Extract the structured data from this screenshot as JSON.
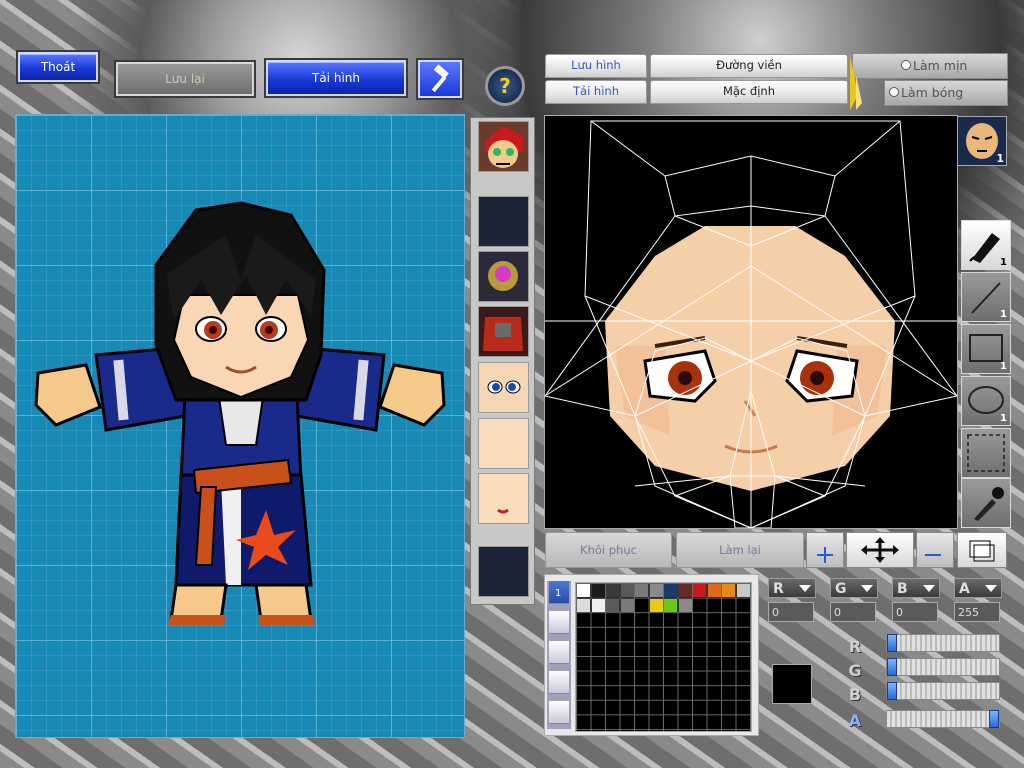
{
  "top_left": {
    "exit_label": "Thoát",
    "save_label": "Lưu lại",
    "reload_label": "Tải hình"
  },
  "editor_top": {
    "save_image_label": "Lưu hình",
    "load_image_label": "Tải hình",
    "outline_label": "Đường viền",
    "default_label": "Mặc định",
    "smooth_label": "Làm mịn",
    "shade_label": "Làm bóng"
  },
  "editor_bottom": {
    "restore_label": "Khôi phục",
    "redo_label": "Làm lại"
  },
  "tools": [
    {
      "icon": "pen-icon",
      "count": "1"
    },
    {
      "icon": "line-icon",
      "count": "1"
    },
    {
      "icon": "rectangle-icon",
      "count": "1"
    },
    {
      "icon": "ellipse-icon",
      "count": "1"
    },
    {
      "icon": "selection-icon",
      "count": ""
    },
    {
      "icon": "eyedropper-icon",
      "count": ""
    }
  ],
  "face_preset_count": "1",
  "color": {
    "channels": [
      {
        "label": "R",
        "value": "0"
      },
      {
        "label": "G",
        "value": "0"
      },
      {
        "label": "B",
        "value": "0"
      },
      {
        "label": "A",
        "value": "255"
      }
    ],
    "current": "#000000",
    "slider_levels": [
      0,
      0,
      0,
      1
    ]
  },
  "palette": [
    "#ffffff",
    "#1a1a1a",
    "#3a3a3a",
    "#5a5a5a",
    "#7a7a7a",
    "#8a8a8a",
    "#1a3a6a",
    "#6a2a2a",
    "#c81a1a",
    "#d86a1a",
    "#e88a1a",
    "#c8c8c8",
    "#dcdcdc",
    "#f0f0f0",
    "#5a5a5a",
    "#7a7a7a",
    "",
    "#e8c81a",
    "#6ac81a",
    "#8a8a8a"
  ],
  "layer_tab_index": "1"
}
